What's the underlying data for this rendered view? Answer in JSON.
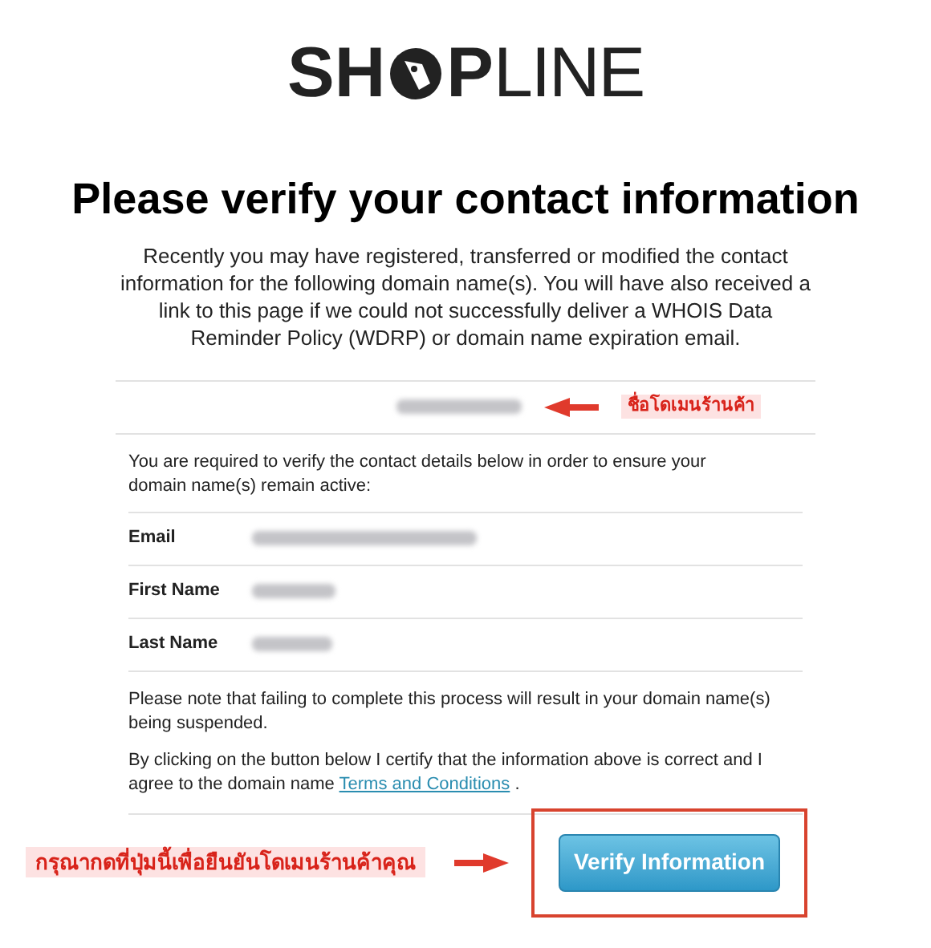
{
  "logo": {
    "bold_start": "SH",
    "bold_end": "P",
    "light": "LINE"
  },
  "heading": "Please verify your contact information",
  "intro": "Recently you may have registered, transferred or modified the contact information for the following domain name(s). You will have also received a link to this page if we could not successfully deliver a WHOIS Data Reminder Policy (WDRP) or domain name expiration email.",
  "domain_note": "ชื่อโดเมนร้านค้า",
  "instruction": "You are required to verify the contact details below in order to ensure your domain name(s) remain active:",
  "fields": [
    {
      "label": "Email"
    },
    {
      "label": "First Name"
    },
    {
      "label": "Last Name"
    }
  ],
  "warning": "Please note that failing to complete this process will result in your domain name(s) being suspended.",
  "certify": {
    "text": "By clicking on the button below I certify that the information above is correct and I agree to the domain name",
    "link": "Terms and Conditions",
    "end": "."
  },
  "button_note": "กรุณากดที่ปุ่มนี้เพื่อยืนยันโดเมนร้านค้าคุณ",
  "button": "Verify Information"
}
